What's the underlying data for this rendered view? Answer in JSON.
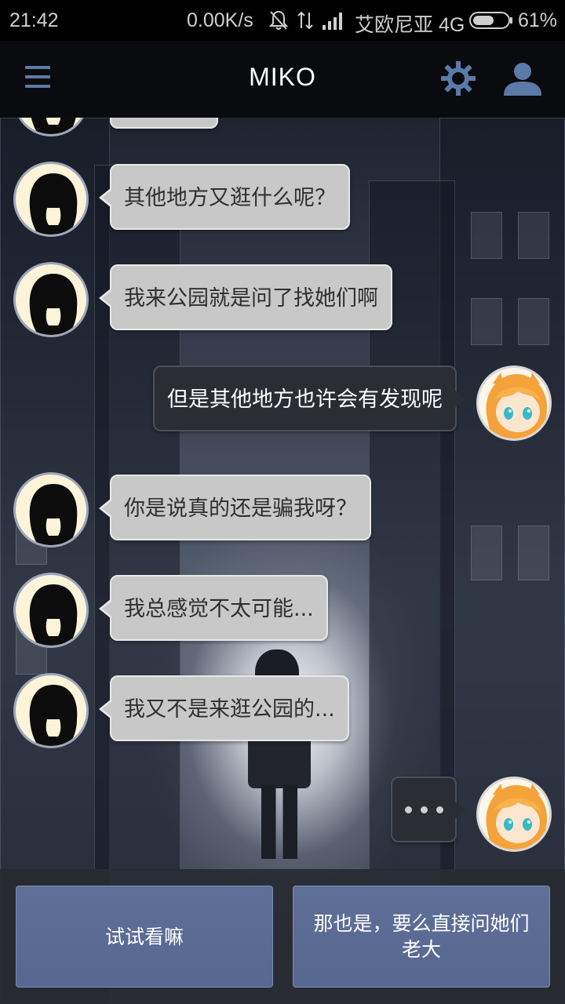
{
  "status_bar": {
    "time": "21:42",
    "net_speed": "0.00K/s",
    "carrier": "艾欧尼亚 4G",
    "battery_percent": "61%",
    "battery_level": 0.61,
    "icons": [
      "bell-muted-icon",
      "data-arrows-icon",
      "signal-icon",
      "battery-icon"
    ]
  },
  "header": {
    "title": "MIKO",
    "icons": [
      "menu-icon",
      "gear-icon",
      "user-icon"
    ],
    "accent_color": "#5c7aa8"
  },
  "messages": [
    {
      "sender": "miko",
      "text": "其他地方又逛什么呢？"
    },
    {
      "sender": "miko",
      "text": "我来公园就是问了找她们啊"
    },
    {
      "sender": "user",
      "text": "但是其他地方也许会有发现呢"
    },
    {
      "sender": "miko",
      "text": "你是说真的还是骗我呀？"
    },
    {
      "sender": "miko",
      "text": "我总感觉不太可能..."
    },
    {
      "sender": "miko",
      "text": "我又不是来逛公园的..."
    },
    {
      "sender": "user",
      "typing": true
    }
  ],
  "replies": [
    {
      "label": "试试看嘛"
    },
    {
      "label": "那也是，要么直接问她们老大"
    }
  ],
  "colors": {
    "miko_bubble": "#c8c8c8",
    "user_bubble": "#2a2d34",
    "reply_button": "#5f7098"
  }
}
